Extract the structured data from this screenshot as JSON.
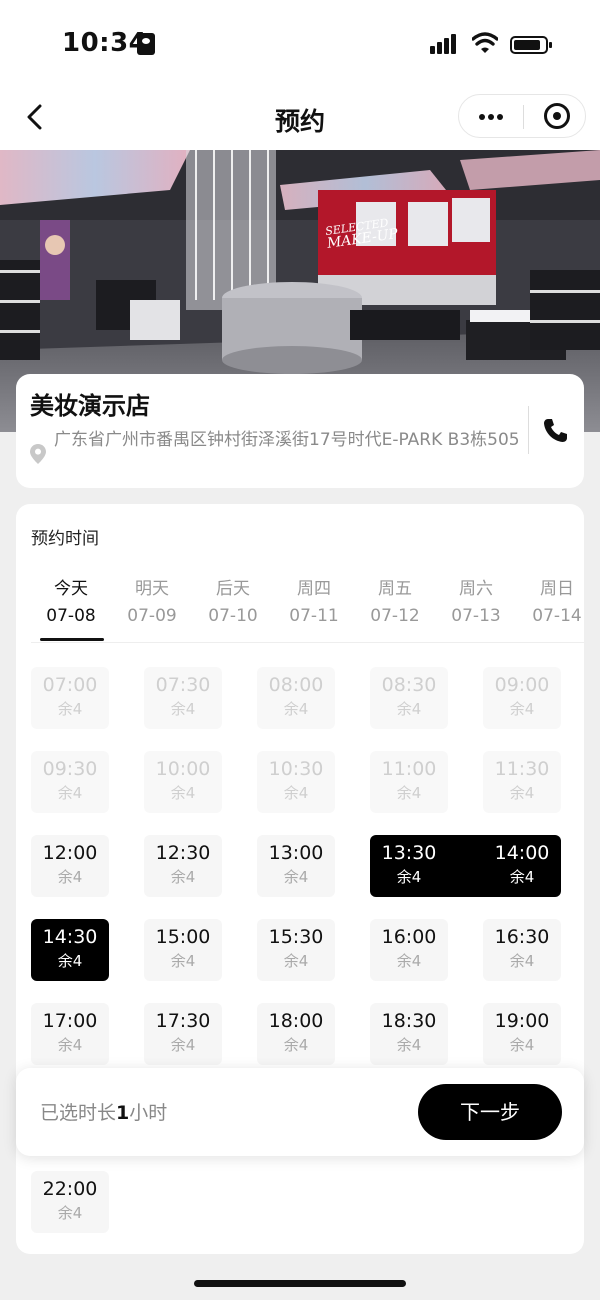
{
  "status_bar": {
    "time": "10:34"
  },
  "nav": {
    "title": "预约"
  },
  "banner": {
    "text_line1": "SELECTED",
    "text_line2": "MAKE-UP"
  },
  "store": {
    "name": "美妆演示店",
    "address": "广东省广州市番禺区钟村街泽溪街17号时代E-PARK B3栋505"
  },
  "booking": {
    "section_title": "预约时间",
    "dates": [
      {
        "day": "今天",
        "date": "07-08",
        "active": true
      },
      {
        "day": "明天",
        "date": "07-09"
      },
      {
        "day": "后天",
        "date": "07-10"
      },
      {
        "day": "周四",
        "date": "07-11"
      },
      {
        "day": "周五",
        "date": "07-12"
      },
      {
        "day": "周六",
        "date": "07-13"
      },
      {
        "day": "周日",
        "date": "07-14"
      }
    ],
    "slots": [
      {
        "time": "07:00",
        "remain": "余4",
        "state": "past"
      },
      {
        "time": "07:30",
        "remain": "余4",
        "state": "past"
      },
      {
        "time": "08:00",
        "remain": "余4",
        "state": "past"
      },
      {
        "time": "08:30",
        "remain": "余4",
        "state": "past"
      },
      {
        "time": "09:00",
        "remain": "余4",
        "state": "past"
      },
      {
        "time": "09:30",
        "remain": "余4",
        "state": "past"
      },
      {
        "time": "10:00",
        "remain": "余4",
        "state": "past"
      },
      {
        "time": "10:30",
        "remain": "余4",
        "state": "past"
      },
      {
        "time": "11:00",
        "remain": "余4",
        "state": "past"
      },
      {
        "time": "11:30",
        "remain": "余4",
        "state": "past"
      },
      {
        "time": "12:00",
        "remain": "余4",
        "state": "available"
      },
      {
        "time": "12:30",
        "remain": "余4",
        "state": "available"
      },
      {
        "time": "13:00",
        "remain": "余4",
        "state": "available"
      },
      {
        "time": "13:30",
        "remain": "余4",
        "state": "selected"
      },
      {
        "time": "14:00",
        "remain": "余4",
        "state": "selected"
      },
      {
        "time": "14:30",
        "remain": "余4",
        "state": "selected"
      },
      {
        "time": "15:00",
        "remain": "余4",
        "state": "available"
      },
      {
        "time": "15:30",
        "remain": "余4",
        "state": "available"
      },
      {
        "time": "16:00",
        "remain": "余4",
        "state": "available"
      },
      {
        "time": "16:30",
        "remain": "余4",
        "state": "available"
      },
      {
        "time": "17:00",
        "remain": "余4",
        "state": "available"
      },
      {
        "time": "17:30",
        "remain": "余4",
        "state": "available"
      },
      {
        "time": "18:00",
        "remain": "余4",
        "state": "available"
      },
      {
        "time": "18:30",
        "remain": "余4",
        "state": "available"
      },
      {
        "time": "19:00",
        "remain": "余4",
        "state": "available"
      },
      {
        "time": "22:00",
        "remain": "余4",
        "state": "available"
      }
    ]
  },
  "footer": {
    "duration_prefix": "已选时长",
    "duration_value": "1",
    "duration_suffix": "小时",
    "next_label": "下一步"
  },
  "colors": {
    "accent": "#000000",
    "page_bg": "#efefef"
  }
}
